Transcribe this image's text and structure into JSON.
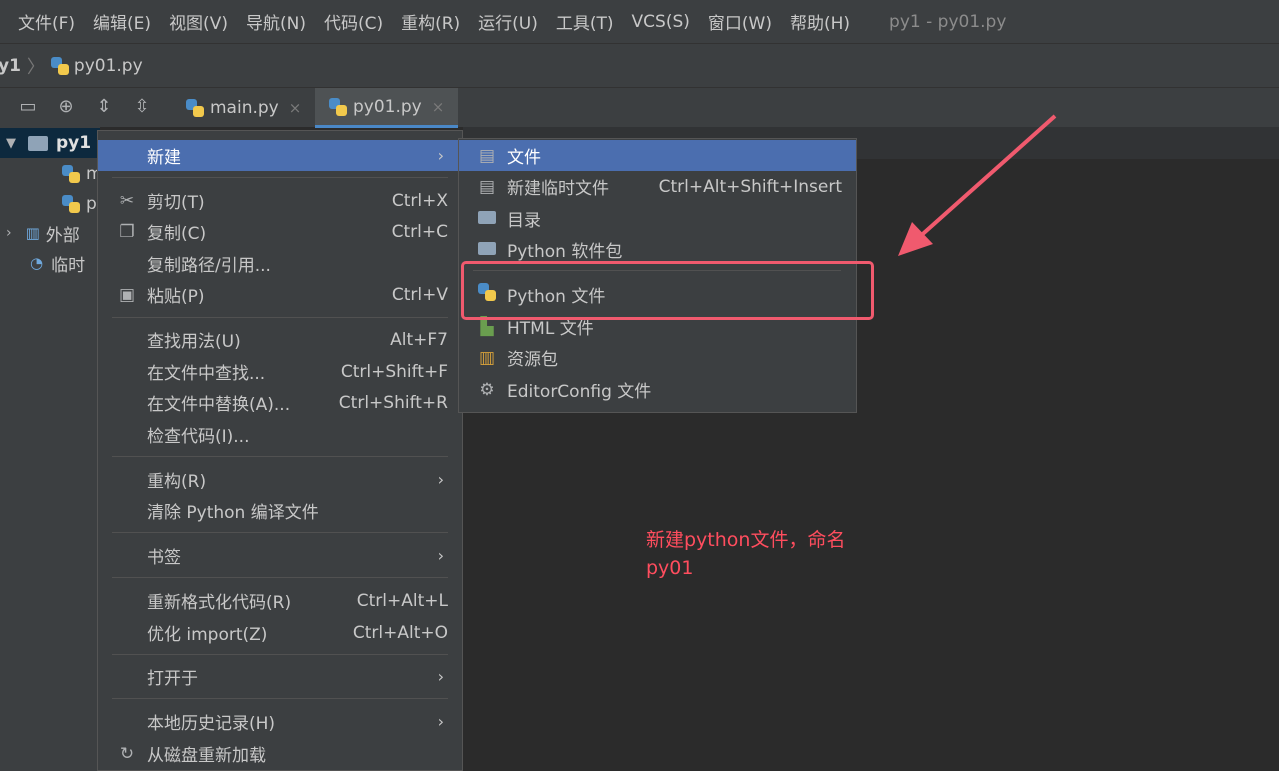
{
  "menubar": {
    "items": [
      "文件(F)",
      "编辑(E)",
      "视图(V)",
      "导航(N)",
      "代码(C)",
      "重构(R)",
      "运行(U)",
      "工具(T)",
      "VCS(S)",
      "窗口(W)",
      "帮助(H)"
    ],
    "title": "py1 - py01.py"
  },
  "navbar": {
    "project": "y1",
    "file": "py01.py"
  },
  "tabs": [
    {
      "label": "main.py",
      "close": "×"
    },
    {
      "label": "py01.py",
      "close": "×"
    }
  ],
  "project_tree": {
    "root": "py1",
    "children": [
      "m",
      "p"
    ],
    "external": "外部",
    "scratch": "临时"
  },
  "context_menu": {
    "items": [
      {
        "label": "新建",
        "shortcut": "",
        "submenu": true,
        "icon": ""
      },
      {
        "label": "剪切(T)",
        "shortcut": "Ctrl+X",
        "icon": "scissors-icon"
      },
      {
        "label": "复制(C)",
        "shortcut": "Ctrl+C",
        "icon": "copy-icon"
      },
      {
        "label": "复制路径/引用...",
        "shortcut": "",
        "icon": ""
      },
      {
        "label": "粘贴(P)",
        "shortcut": "Ctrl+V",
        "icon": "paste-icon"
      },
      {
        "label": "查找用法(U)",
        "shortcut": "Alt+F7",
        "icon": ""
      },
      {
        "label": "在文件中查找...",
        "shortcut": "Ctrl+Shift+F",
        "icon": ""
      },
      {
        "label": "在文件中替换(A)...",
        "shortcut": "Ctrl+Shift+R",
        "icon": ""
      },
      {
        "label": "检查代码(I)...",
        "shortcut": "",
        "icon": ""
      },
      {
        "label": "重构(R)",
        "shortcut": "",
        "submenu": true,
        "icon": ""
      },
      {
        "label": "清除 Python 编译文件",
        "shortcut": "",
        "icon": ""
      },
      {
        "label": "书签",
        "shortcut": "",
        "submenu": true,
        "icon": ""
      },
      {
        "label": "重新格式化代码(R)",
        "shortcut": "Ctrl+Alt+L",
        "icon": ""
      },
      {
        "label": "优化 import(Z)",
        "shortcut": "Ctrl+Alt+O",
        "icon": ""
      },
      {
        "label": "打开于",
        "shortcut": "",
        "submenu": true,
        "icon": ""
      },
      {
        "label": "本地历史记录(H)",
        "shortcut": "",
        "submenu": true,
        "icon": ""
      },
      {
        "label": "从磁盘重新加载",
        "shortcut": "",
        "icon": "reload-icon"
      }
    ],
    "arrow": "›"
  },
  "submenu": {
    "items": [
      {
        "label": "文件",
        "shortcut": "",
        "icon": "file-icon"
      },
      {
        "label": "新建临时文件",
        "shortcut": "Ctrl+Alt+Shift+Insert",
        "icon": "scratch-file-icon"
      },
      {
        "label": "目录",
        "shortcut": "",
        "icon": "folder-icon"
      },
      {
        "label": "Python 软件包",
        "shortcut": "",
        "icon": "package-icon"
      },
      {
        "label": "Python 文件",
        "shortcut": "",
        "icon": "python-file-icon"
      },
      {
        "label": "HTML 文件",
        "shortcut": "",
        "icon": "html-file-icon"
      },
      {
        "label": "资源包",
        "shortcut": "",
        "icon": "resource-bundle-icon"
      },
      {
        "label": "EditorConfig 文件",
        "shortcut": "",
        "icon": "gear-icon"
      }
    ]
  },
  "annotation": {
    "line1": "新建python文件，命名",
    "line2": "py01"
  },
  "colors": {
    "highlight": "#4b6eaf",
    "annotation": "#f05a6e"
  }
}
